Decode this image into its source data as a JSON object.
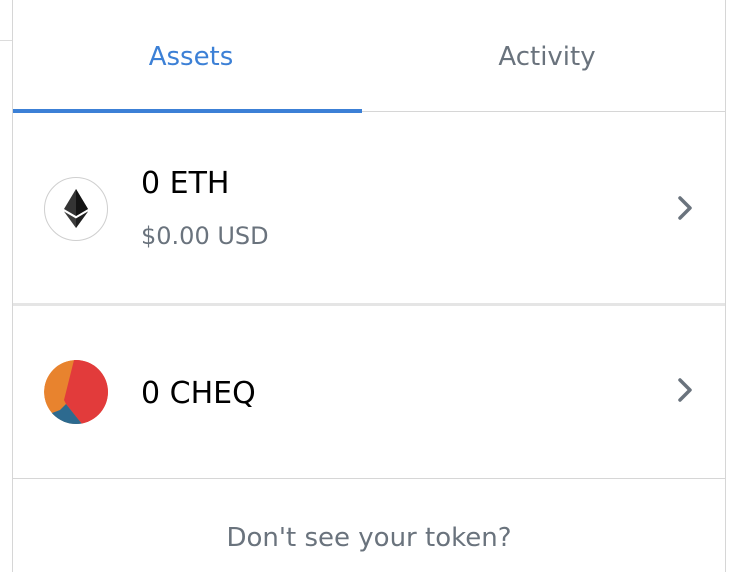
{
  "tabs": [
    {
      "label": "Assets",
      "active": true
    },
    {
      "label": "Activity",
      "active": false
    }
  ],
  "assets": [
    {
      "balance": "0 ETH",
      "fiat": "$0.00 USD",
      "icon": "ethereum-icon"
    },
    {
      "balance": "0 CHEQ",
      "icon": "cheq-token-icon"
    }
  ],
  "footer": {
    "link_text": "Don't see your token?"
  },
  "colors": {
    "accent": "#3c80d6",
    "secondary_text": "#6a737d",
    "border": "#d6d6d6"
  }
}
